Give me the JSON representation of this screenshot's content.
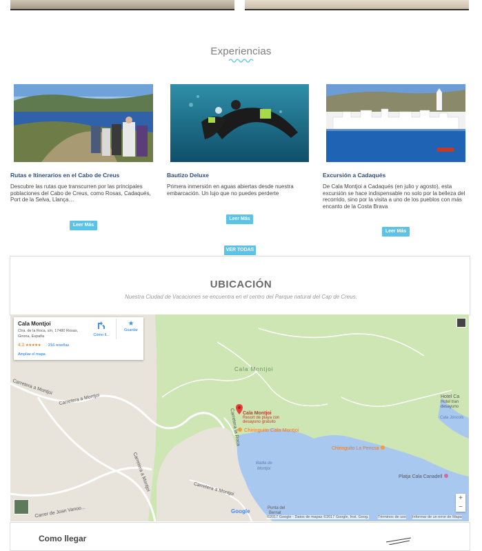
{
  "section": {
    "title": "Experiencias",
    "see_all": "VER TODAS"
  },
  "cards": [
    {
      "title": "Rutas e Itinerarios en el Cabo de Creus",
      "text": "Descubre las rutas que transcurren por las principales poblaciones del Cabo de Creus, como Rosas, Cadaqués, Port de la Selva, Llança…",
      "button": "Leer Más"
    },
    {
      "title": "Bautizo Deluxe",
      "text": "Primera inmersión en aguas abiertas desde nuestra embarcación. Un lujo que no puedes perderte",
      "button": "Leer Más"
    },
    {
      "title": "Excursión a Cadaqués",
      "text": "De Cala Montjoi a Cadaqués (en julio y agosto), esta excursión se hace indispensable no solo por la belleza del recorrido, sino por la visita a uno de los pueblos con más encanto de la Costa Brava",
      "button": "Leer Más"
    }
  ],
  "location": {
    "title": "UBICACIÓN",
    "subtitle": "Nuestra Ciudad de Vacaciones se encuentra en el centro del Parque natural del Cap de Creus."
  },
  "map_card": {
    "name": "Cala Montjoi",
    "address": "Ctra. de la Roca, s/n, 17480 Rosas, Girona, España",
    "rating": "4,3",
    "stars": "★★★★★",
    "reviews": "216 reseñas",
    "enlarge": "Ampliar el mapa",
    "directions": "Cómo ll...",
    "save": "Guardar"
  },
  "map": {
    "labels": {
      "cala_montjoi": "Cala Montjoi",
      "carretera1": "Carretera a Montjoi",
      "carretera2": "Carretera a Montjoi",
      "carretera3": "Carretera a Montjoi",
      "carretera4": "Carretera a Montjoi",
      "carretera5": "Carrer de Joan Vanoo...",
      "carretera_roca": "Carretera la Roca",
      "pin_name": "Cala Montjoi",
      "pin_desc1": "Resort de playa con",
      "pin_desc2": "desayuno gratuito",
      "chiringuito": "Chiringuito Cala Montjoi",
      "chiringuito2": "Chiringuito La Pericsa",
      "badia": "Badia de",
      "badia2": "Montjoi",
      "platja": "Platja Cala Canadell",
      "cala_jonculs": "Cala Jóncols",
      "hotel": "Hotel Ca",
      "hotel2": "Hotel tran",
      "hotel3": "desayuno",
      "punta": "Punta del",
      "punta2": "Bernat",
      "google": "Google",
      "attribution": "©2017 Google - Datos de mapas ©2017 Google, Inst. Geog.",
      "terms": "Términos de uso",
      "report": "Informar de un error de Mapa"
    },
    "zoom_in": "+",
    "zoom_out": "−"
  },
  "footer": {
    "heading": "Como llegar"
  },
  "colors": {
    "accent": "#5cc3e6",
    "title_blue": "#2c4c7c",
    "land": "#cde6b4",
    "sea": "#a8c8f0"
  }
}
